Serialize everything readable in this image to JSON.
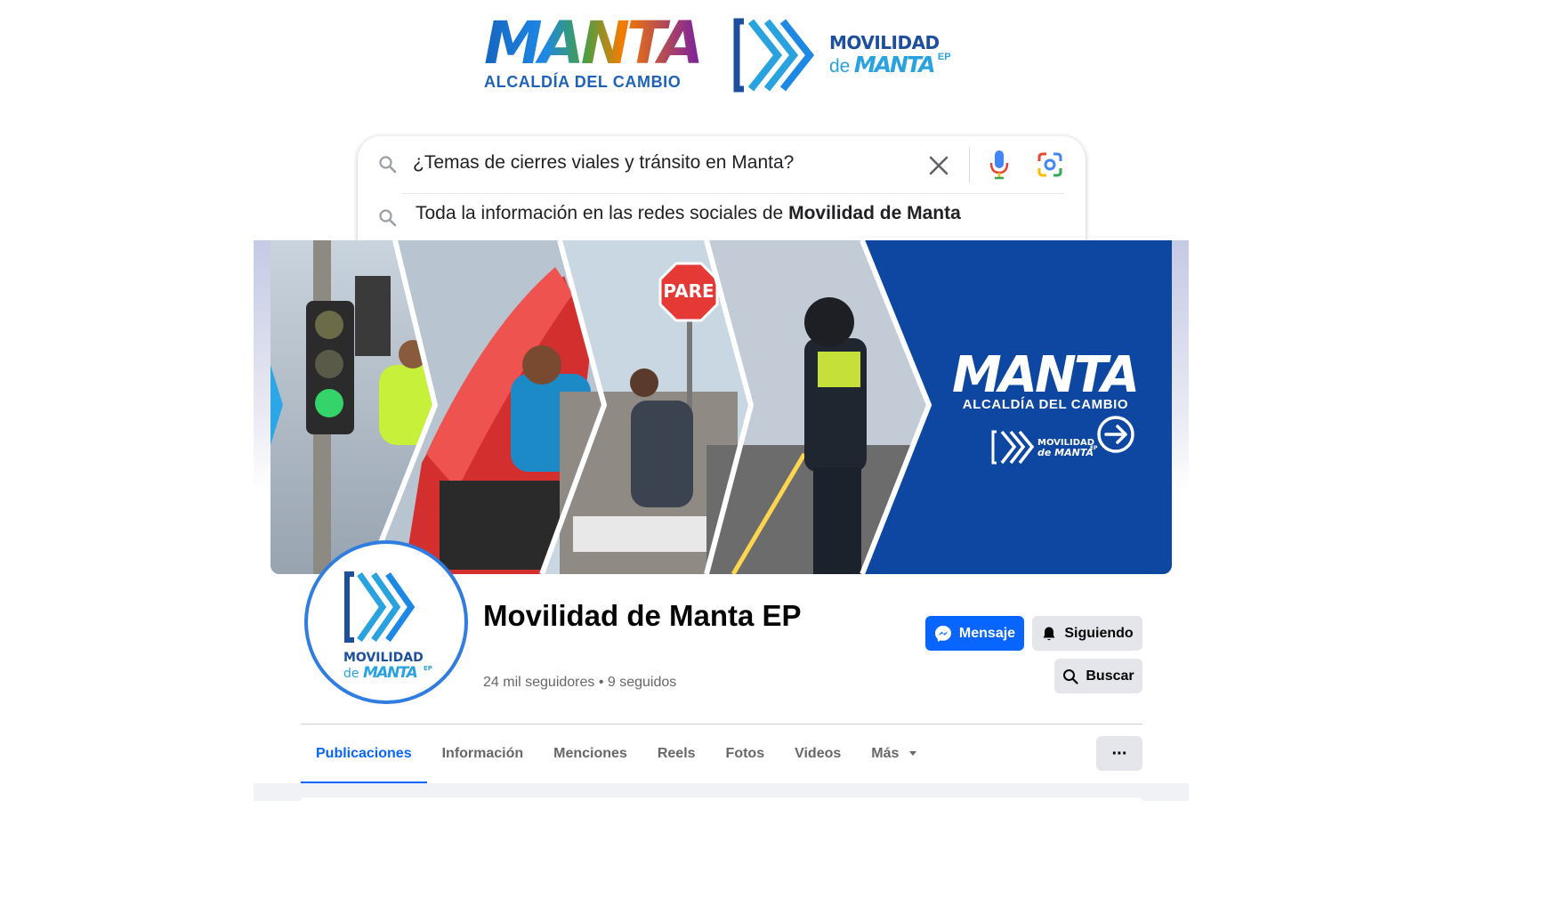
{
  "logos": {
    "manta": {
      "word": "MANTA",
      "subtitle": "ALCALDÍA DEL CAMBIO"
    },
    "movilidad": {
      "line1": "MOVILIDAD",
      "de": "de",
      "manta": "MANTA",
      "ep": "EP"
    }
  },
  "search": {
    "query": "¿Temas de cierres viales y tránsito en Manta?",
    "suggestion_prefix": "Toda la información en las redes sociales de ",
    "suggestion_bold": "Movilidad de Manta",
    "icons": [
      "search-icon",
      "clear-icon",
      "mic-icon",
      "lens-icon"
    ]
  },
  "cover": {
    "stop_sign": "PARE",
    "brand_word": "MANTA",
    "brand_subtitle": "ALCALDÍA DEL CAMBIO",
    "mov_line1": "MOVILIDAD",
    "mov_line2": "de MANTA",
    "mov_ep": "EP",
    "background_color": "#0d47a1"
  },
  "profile": {
    "avatar": {
      "line1": "MOVILIDAD",
      "de": "de",
      "manta": "MANTA",
      "ep": "EP"
    },
    "name": "Movilidad de Manta EP",
    "stats": "24 mil seguidores • 9 seguidos",
    "buttons": {
      "message": "Mensaje",
      "following": "Siguiendo",
      "search": "Buscar",
      "more": "···"
    }
  },
  "tabs": [
    {
      "label": "Publicaciones",
      "active": true
    },
    {
      "label": "Información",
      "active": false
    },
    {
      "label": "Menciones",
      "active": false
    },
    {
      "label": "Reels",
      "active": false
    },
    {
      "label": "Fotos",
      "active": false
    },
    {
      "label": "Videos",
      "active": false
    },
    {
      "label": "Más",
      "active": false
    }
  ],
  "colors": {
    "accent": "#0866ff",
    "brand_blue": "#1e4f9c",
    "brand_cyan": "#29a3e0"
  }
}
